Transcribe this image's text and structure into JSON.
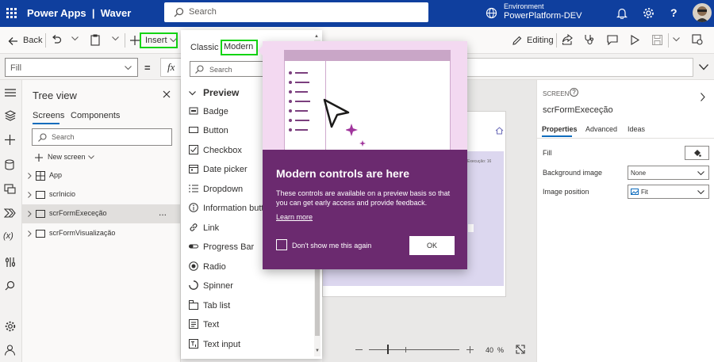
{
  "app": {
    "brand": "Power Apps  |  Waver"
  },
  "search": {
    "placeholder": "Search"
  },
  "environment": {
    "label": "Environment",
    "value": "PowerPlatform-DEV"
  },
  "toolbar": {
    "back": "Back",
    "insert": "Insert",
    "editing": "Editing",
    "more": "..."
  },
  "formula": {
    "property": "Fill",
    "equals": "=",
    "fx": "fx"
  },
  "tree": {
    "title": "Tree view",
    "tabs": [
      "Screens",
      "Components"
    ],
    "search_placeholder": "Search",
    "new_screen": "New screen",
    "items": [
      "App",
      "scrInicio",
      "scrFormExeceção",
      "scrFormVisualização"
    ],
    "more": "..."
  },
  "insert_menu": {
    "tabs": {
      "classic": "Classic",
      "modern": "Modern"
    },
    "search_placeholder": "Search",
    "section": "Preview",
    "items": [
      "Badge",
      "Button",
      "Checkbox",
      "Date picker",
      "Dropdown",
      "Information button",
      "Link",
      "Progress Bar",
      "Radio",
      "Spinner",
      "Tab list",
      "Text",
      "Text input"
    ]
  },
  "popup": {
    "title": "Modern controls are here",
    "body": "These controls are available on a preview basis so that you can get early access and provide feedback.",
    "learn_more": "Learn more",
    "checkbox_label": "Don't show me this again",
    "ok": "OK"
  },
  "canvas": {
    "zoom_value": "40",
    "zoom_unit": "%",
    "form_caption": "Execução: 16"
  },
  "right_panel": {
    "header": "SCREEN",
    "name": "scrFormExeceção",
    "tabs": [
      "Properties",
      "Advanced",
      "Ideas"
    ],
    "fill_label": "Fill",
    "bg_image_label": "Background image",
    "bg_image_value": "None",
    "img_pos_label": "Image position",
    "img_pos_value": "Fit"
  },
  "colors": {
    "topbar": "#0f3f9e",
    "highlight": "#13d413",
    "popup": "#6b2a6f",
    "accent": "#0f6cbd"
  }
}
